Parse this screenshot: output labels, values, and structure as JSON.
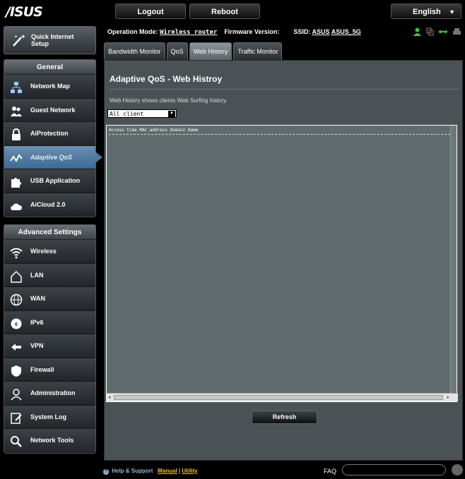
{
  "header": {
    "logo": "/ISUS",
    "logout_label": "Logout",
    "reboot_label": "Reboot",
    "language_label": "English"
  },
  "status": {
    "op_mode_label": "Operation Mode:",
    "op_mode_value": "Wireless router",
    "fw_label": "Firmware Version:",
    "ssid_label": "SSID:",
    "ssid_1": "ASUS",
    "ssid_2": "ASUS_5G",
    "icons": [
      "user-icon",
      "copy-icon",
      "usb-icon",
      "printer-icon"
    ]
  },
  "sidebar": {
    "quick_setup_line1": "Quick Internet",
    "quick_setup_line2": "Setup",
    "general_header": "General",
    "general_items": [
      {
        "label": "Network Map",
        "icon": "network-map-icon"
      },
      {
        "label": "Guest Network",
        "icon": "guest-network-icon"
      },
      {
        "label": "AiProtection",
        "icon": "lock-icon"
      },
      {
        "label": "Adaptive QoS",
        "icon": "qos-icon"
      },
      {
        "label": "USB Application",
        "icon": "puzzle-icon"
      },
      {
        "label": "AiCloud 2.0",
        "icon": "cloud-icon"
      }
    ],
    "advanced_header": "Advanced Settings",
    "advanced_items": [
      {
        "label": "Wireless",
        "icon": "wifi-icon"
      },
      {
        "label": "LAN",
        "icon": "home-icon"
      },
      {
        "label": "WAN",
        "icon": "globe-icon"
      },
      {
        "label": "IPv6",
        "icon": "ipv6-icon"
      },
      {
        "label": "VPN",
        "icon": "vpn-icon"
      },
      {
        "label": "Firewall",
        "icon": "shield-icon"
      },
      {
        "label": "Administration",
        "icon": "admin-icon"
      },
      {
        "label": "System Log",
        "icon": "log-icon"
      },
      {
        "label": "Network Tools",
        "icon": "tools-icon"
      }
    ]
  },
  "tabs": [
    {
      "label": "Bandwidth Monitor",
      "active": false
    },
    {
      "label": "QoS",
      "active": false
    },
    {
      "label": "Web History",
      "active": true
    },
    {
      "label": "Traffic Monitor",
      "active": false
    }
  ],
  "main": {
    "title": "Adaptive QoS - Web Histroy",
    "description": "Web History shows clients Web Surfing history.",
    "client_select": "All client",
    "log_header": "Access time MAC address Domain Name",
    "refresh_label": "Refresh"
  },
  "footer": {
    "help_label": "Help & Support",
    "manual_label": "Manual",
    "separator": "|",
    "utility_label": "Utility",
    "faq_label": "FAQ"
  }
}
